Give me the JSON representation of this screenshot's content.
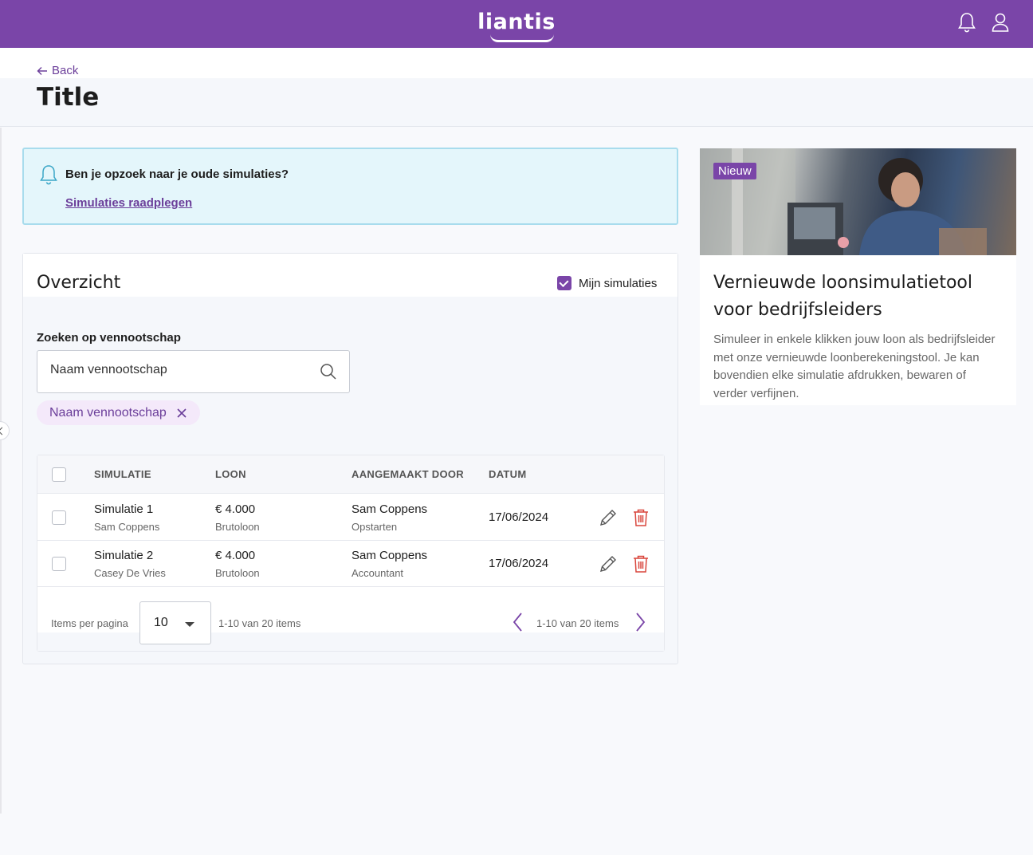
{
  "brand": {
    "logo": "liantis",
    "color": "#7a45a8"
  },
  "topbar": {
    "icons": [
      "bell-icon",
      "user-icon"
    ]
  },
  "header": {
    "back_label": "Back",
    "title": "Title"
  },
  "alert": {
    "text": "Ben je opzoek naar je oude simulaties?",
    "link": "Simulaties raadplegen"
  },
  "overview": {
    "title": "Overzicht",
    "mine_label": "Mijn simulaties",
    "mine_checked": true,
    "search_label": "Zoeken op vennootschap",
    "search_placeholder": "Naam vennootschap",
    "chip_label": "Naam vennootschap"
  },
  "table": {
    "columns": [
      "SIMULATIE",
      "LOON",
      "AANGEMAAKT DOOR",
      "DATUM"
    ],
    "rows": [
      {
        "name": "Simulatie 1",
        "owner": "Sam Coppens",
        "salary": "€ 4.000",
        "salary_type": "Brutoloon",
        "creator": "Sam Coppens",
        "creator_role": "Opstarten",
        "date": "17/06/2024"
      },
      {
        "name": "Simulatie 2",
        "owner": "Casey De Vries",
        "salary": "€ 4.000",
        "salary_type": "Brutoloon",
        "creator": "Sam Coppens",
        "creator_role": "Accountant",
        "date": "17/06/2024"
      }
    ],
    "footer": {
      "items_per_page_label": "Items per pagina",
      "items_per_page": "10",
      "range_left": "1-10 van 20 items",
      "range_right": "1-10 van 20 items"
    }
  },
  "promo": {
    "badge": "Nieuw",
    "title": "Vernieuwde loonsimulatietool voor bedrijfsleiders",
    "text": "Simuleer in enkele klikken jouw loon als bedrijfsleider met onze vernieuwde loonberekeningstool. Je kan bovendien elke simulatie afdrukken, bewaren of verder verfijnen."
  }
}
